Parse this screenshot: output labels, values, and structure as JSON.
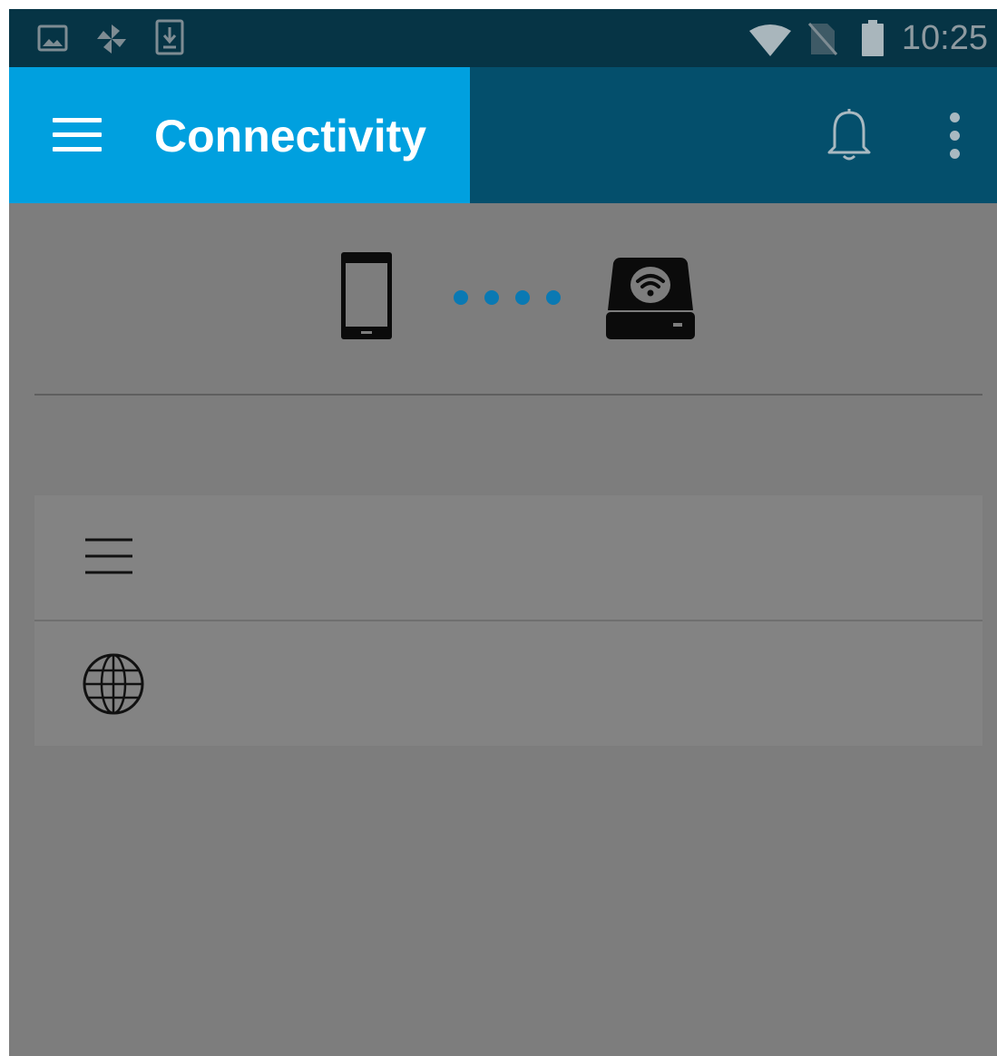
{
  "status_bar": {
    "time": "10:25",
    "left_icons": [
      "gallery-icon",
      "pinwheel-icon",
      "download-icon"
    ],
    "right_icons": [
      "wifi-icon",
      "no-sim-icon",
      "battery-icon"
    ]
  },
  "app_bar": {
    "title": "Connectivity",
    "colors": {
      "title_panel": "#00a0df",
      "bar": "#044f6c"
    }
  },
  "hero": {
    "left_device": "phone-icon",
    "right_device": "wireless-drive-icon",
    "link_dots": 4,
    "dot_color": "#0a79b3"
  },
  "list": {
    "items": [
      {
        "icon": "list-lines-icon",
        "label": ""
      },
      {
        "icon": "globe-icon",
        "label": ""
      }
    ]
  }
}
